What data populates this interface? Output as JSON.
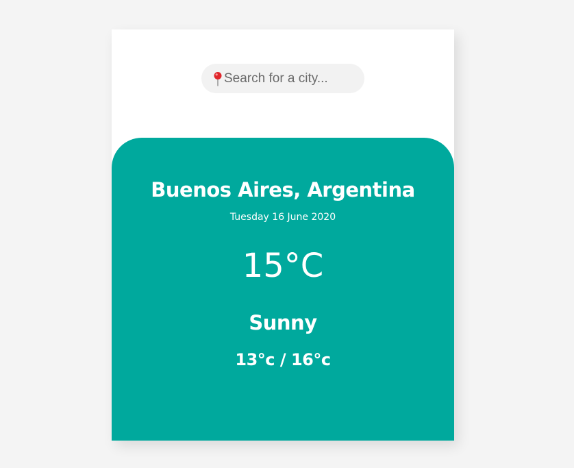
{
  "search": {
    "icon": "map-pin-icon",
    "placeholder": "Search for a city..."
  },
  "weather": {
    "location": "Buenos Aires, Argentina",
    "date": "Tuesday 16 June 2020",
    "temperature": "15°C",
    "condition": "Sunny",
    "range": "13°c / 16°c"
  },
  "colors": {
    "background": "#f4f4f4",
    "card": "#ffffff",
    "accent": "#00a99d",
    "search_bg": "#f2f2f2",
    "pin": "#e0262b"
  }
}
